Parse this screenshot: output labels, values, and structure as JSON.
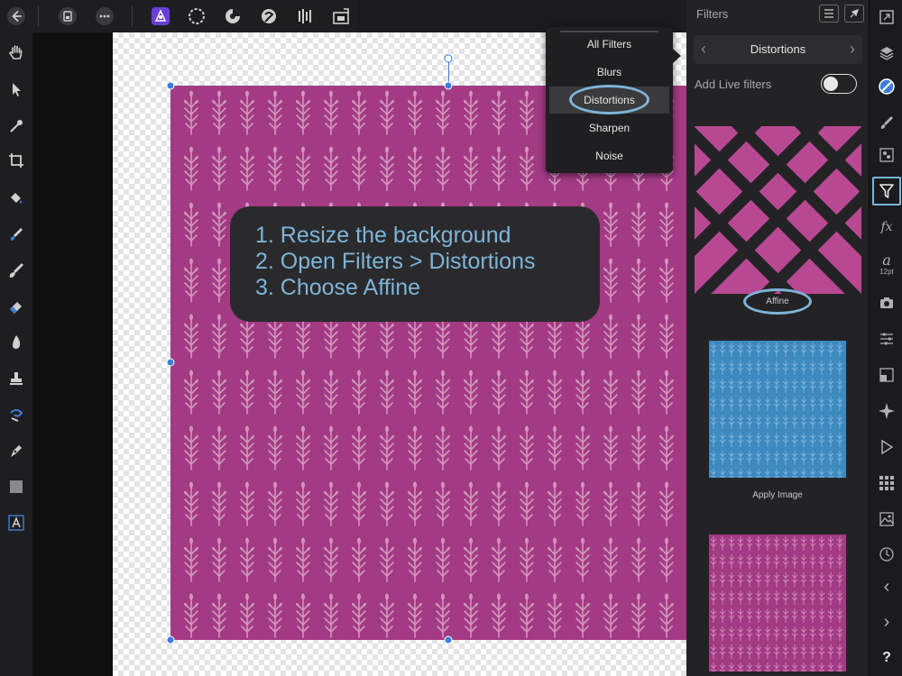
{
  "panel": {
    "title": "Filters",
    "category": "Distortions",
    "live_filters_label": "Add Live filters",
    "thumbnails": [
      {
        "caption": "Affine"
      },
      {
        "caption": "Apply Image"
      },
      {
        "caption": ""
      }
    ]
  },
  "dropdown": {
    "items": [
      "All Filters",
      "Blurs",
      "Distortions",
      "Sharpen",
      "Noise"
    ],
    "selected": "Distortions"
  },
  "callout": {
    "lines": [
      "1. Resize the background",
      "2. Open Filters > Distortions",
      "3. Choose Affine"
    ]
  },
  "studio": {
    "text_size_label": "12pt",
    "fx_label": "fx",
    "help_label": "?",
    "text_glyph": "a"
  },
  "colors": {
    "accent_ring": "#7eb4d8",
    "magenta_paper": "#a33a84",
    "blue_thumb": "#3d89c0",
    "selection_handle": "#3f7ed8"
  }
}
